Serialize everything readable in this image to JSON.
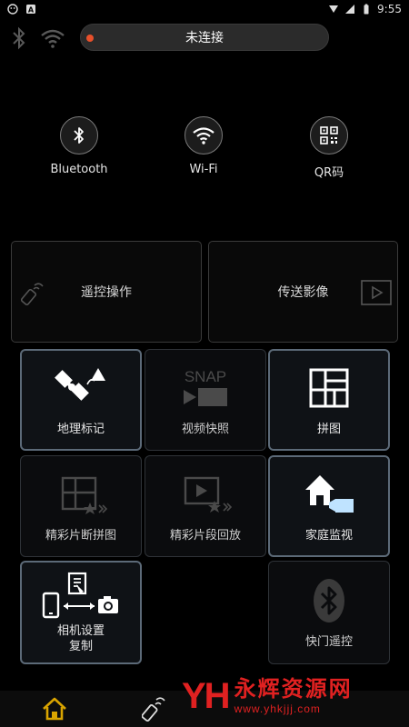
{
  "status_bar": {
    "time": "9:55"
  },
  "connection": {
    "status_text": "未连接"
  },
  "quick_connect": [
    {
      "label": "Bluetooth",
      "icon": "bluetooth-icon"
    },
    {
      "label": "Wi-Fi",
      "icon": "wifi-icon"
    },
    {
      "label": "QR码",
      "icon": "qr-code-icon"
    }
  ],
  "big_tiles": {
    "remote": "遥控操作",
    "transfer": "传送影像"
  },
  "grid_tiles": {
    "geotag": "地理标记",
    "snapshot": "视频快照",
    "collage": "拼图",
    "highlight_collage": "精彩片断拼图",
    "highlight_playback": "精彩片段回放",
    "home_monitor": "家庭监视",
    "copy_settings_line1": "相机设置",
    "copy_settings_line2": "复制",
    "shutter_remote": "快门遥控"
  },
  "snap_text": "SNAP",
  "watermark": {
    "mark": "YH",
    "name": "永辉资源网",
    "url": "www.yhkjjj.com"
  },
  "colors": {
    "accent_orange": "#e8502b",
    "home_icon": "#d9a400",
    "watermark_red": "#e02121"
  }
}
